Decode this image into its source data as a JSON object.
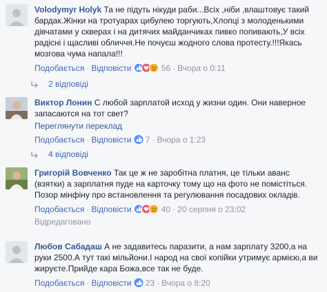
{
  "comments": [
    {
      "name": "Volodymyr Holyk",
      "text": "Та не підуть нікуди раби...Всіх ,ніби ,влаштовує такий бардак.Жінки на тротуарах цибулею торгують,Хлопці з молоденькими дівчатами у скверах і на дитячих майданчиках пивко попивають,У всіх радісні і щасливі обличчя.Не почуєш жодного слова протесту.!!!Якась мозгова чума напала!!!",
      "like_label": "Подобається",
      "reply_label": "Відповісти",
      "reactions": [
        "like-reaction",
        "love-reaction",
        "sad-reaction"
      ],
      "reaction_count": "56",
      "time": "Вчора о 0:11",
      "replies_label": "2 відповіді"
    },
    {
      "name": "Виктор Лонин",
      "text": "С любой зарплатой исход у жизни один. Они наверное запасаются на тот свет?",
      "translate_label": "Переглянути переклад",
      "like_label": "Подобається",
      "reply_label": "Відповісти",
      "reactions": [
        "like-reaction"
      ],
      "reaction_count": "7",
      "time": "Вчора о 1:23",
      "replies_label": "4 відповіді"
    },
    {
      "name": "Григорій Вовченко",
      "text": "Так це ж не заробітна платня, це тільки аванс (взятки) а зарплатня пуде на карточку тому що на фото не помістіться. Позор мінфіну про встановлення та регулювання посадових окладів.",
      "like_label": "Подобається",
      "reply_label": "Відповісти",
      "reactions": [
        "like-reaction",
        "love-reaction",
        "sad-reaction"
      ],
      "reaction_count": "40",
      "time": "20 серпня о 23:02",
      "edited_label": "Відредаговано"
    },
    {
      "name": "Любов Сабадаш",
      "text": "А не задавитесь паразити, а нам зарплату 3200,а на руки 2500.А тут такі мільйони.І народ на свої копійки утримує армією,а ви жируєте.Прийде кара Божа,все так не буде.",
      "like_label": "Подобається",
      "reply_label": "Відповісти",
      "reactions": [
        "like-reaction"
      ],
      "reaction_count": "23",
      "time": "Вчора о 8:20"
    }
  ],
  "colors": {
    "name": "#365899",
    "link": "#4267b2",
    "meta": "#90949c",
    "like": "#5890ff",
    "love": "#f25268",
    "sad": "#f7b125"
  }
}
